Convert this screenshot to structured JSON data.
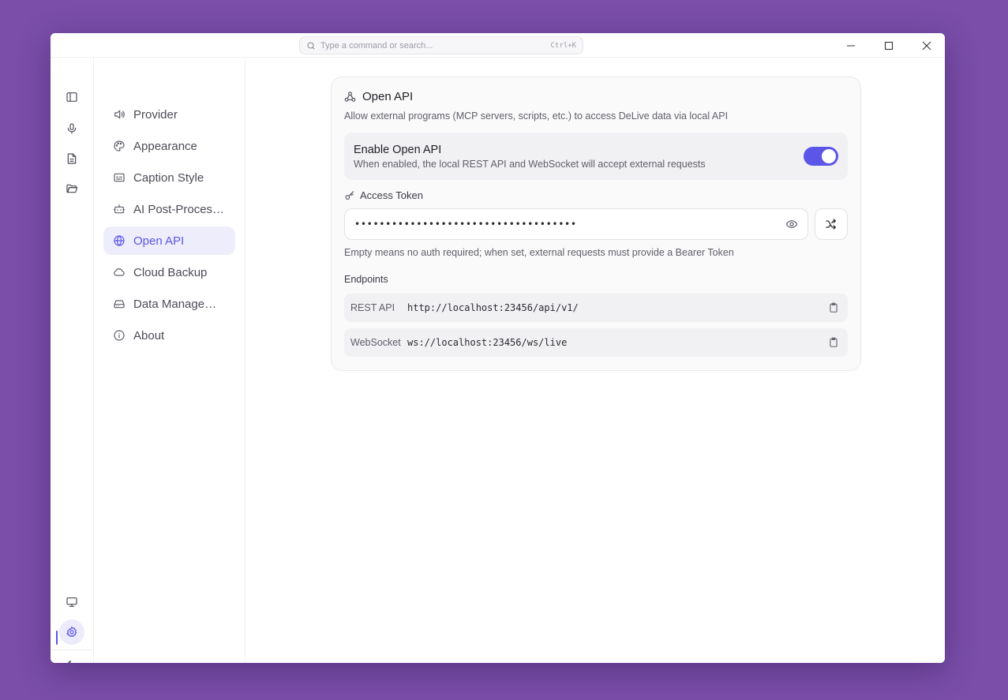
{
  "search": {
    "placeholder": "Type a command or search...",
    "shortcut": "Ctrl+K"
  },
  "rail": {
    "top_icons": [
      "sidebar-toggle-icon",
      "microphone-icon",
      "document-icon",
      "folder-icon"
    ],
    "bottom_icons": [
      "monitor-icon",
      "gear-icon",
      "moon-icon"
    ]
  },
  "nav": {
    "items": [
      {
        "label": "Provider",
        "icon": "speaker-icon"
      },
      {
        "label": "Appearance",
        "icon": "palette-icon"
      },
      {
        "label": "Caption Style",
        "icon": "caption-icon"
      },
      {
        "label": "AI Post-Processing",
        "icon": "bot-icon"
      },
      {
        "label": "Open API",
        "icon": "globe-icon"
      },
      {
        "label": "Cloud Backup",
        "icon": "cloud-icon"
      },
      {
        "label": "Data Management",
        "icon": "drive-icon"
      },
      {
        "label": "About",
        "icon": "info-icon"
      }
    ],
    "active_index": 4
  },
  "card": {
    "title": "Open API",
    "description": "Allow external programs (MCP servers, scripts, etc.) to access DeLive data via local API",
    "enable": {
      "title": "Enable Open API",
      "subtitle": "When enabled, the local REST API and WebSocket will accept external requests",
      "enabled": true
    },
    "token": {
      "label": "Access Token",
      "masked_value": "••••••••••••••••••••••••••••••••••••",
      "hint": "Empty means no auth required; when set, external requests must provide a Bearer Token"
    },
    "endpoints": {
      "label": "Endpoints",
      "rows": [
        {
          "name": "REST API",
          "url": "http://localhost:23456/api/v1/"
        },
        {
          "name": "WebSocket",
          "url": "ws://localhost:23456/ws/live"
        }
      ]
    }
  },
  "colors": {
    "accent": "#5b56e8",
    "background": "#7a4ea9"
  }
}
